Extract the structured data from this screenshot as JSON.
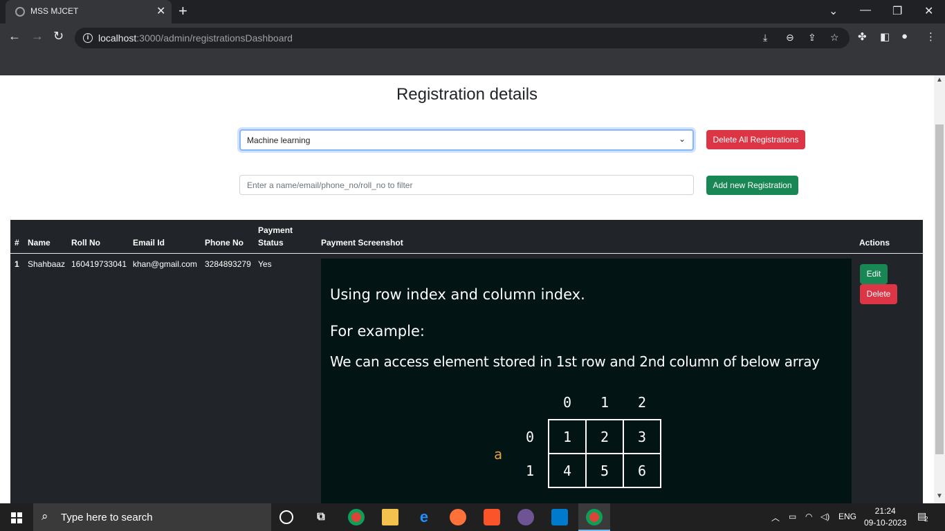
{
  "browser": {
    "tab_title": "MSS MJCET",
    "url_host": "localhost",
    "url_rest": ":3000/admin/registrationsDashboard"
  },
  "page": {
    "title": "Registration details",
    "select_value": "Machine learning",
    "delete_all_label": "Delete All Registrations",
    "filter_placeholder": "Enter a name/email/phone_no/roll_no to filter",
    "add_new_label": "Add new Registration"
  },
  "table": {
    "headers": {
      "index": "#",
      "name": "Name",
      "roll_no": "Roll No",
      "email": "Email Id",
      "phone": "Phone No",
      "payment_status_1": "Payment",
      "payment_status_2": "Status",
      "payment_screenshot": "Payment Screenshot",
      "actions": "Actions"
    },
    "rows": [
      {
        "index": "1",
        "name": "Shahbaaz",
        "roll_no": "160419733041",
        "email": "khan@gmail.com",
        "phone": "3284893279",
        "payment_status": "Yes",
        "edit_label": "Edit",
        "delete_label": "Delete",
        "screenshot": {
          "line1": "Using row index and column index.",
          "line2": "For example:",
          "line3": "We can access element stored in 1st row and 2nd column of below array",
          "col_indices": [
            "0",
            "1",
            "2"
          ],
          "row_indices": [
            "0",
            "1"
          ],
          "array_name": "a",
          "grid": [
            [
              "1",
              "2",
              "3"
            ],
            [
              "4",
              "5",
              "6"
            ]
          ]
        }
      }
    ]
  },
  "taskbar": {
    "search_placeholder": "Type here to search",
    "language": "ENG",
    "time": "21:24",
    "date": "09-10-2023",
    "notification_count": "2"
  }
}
